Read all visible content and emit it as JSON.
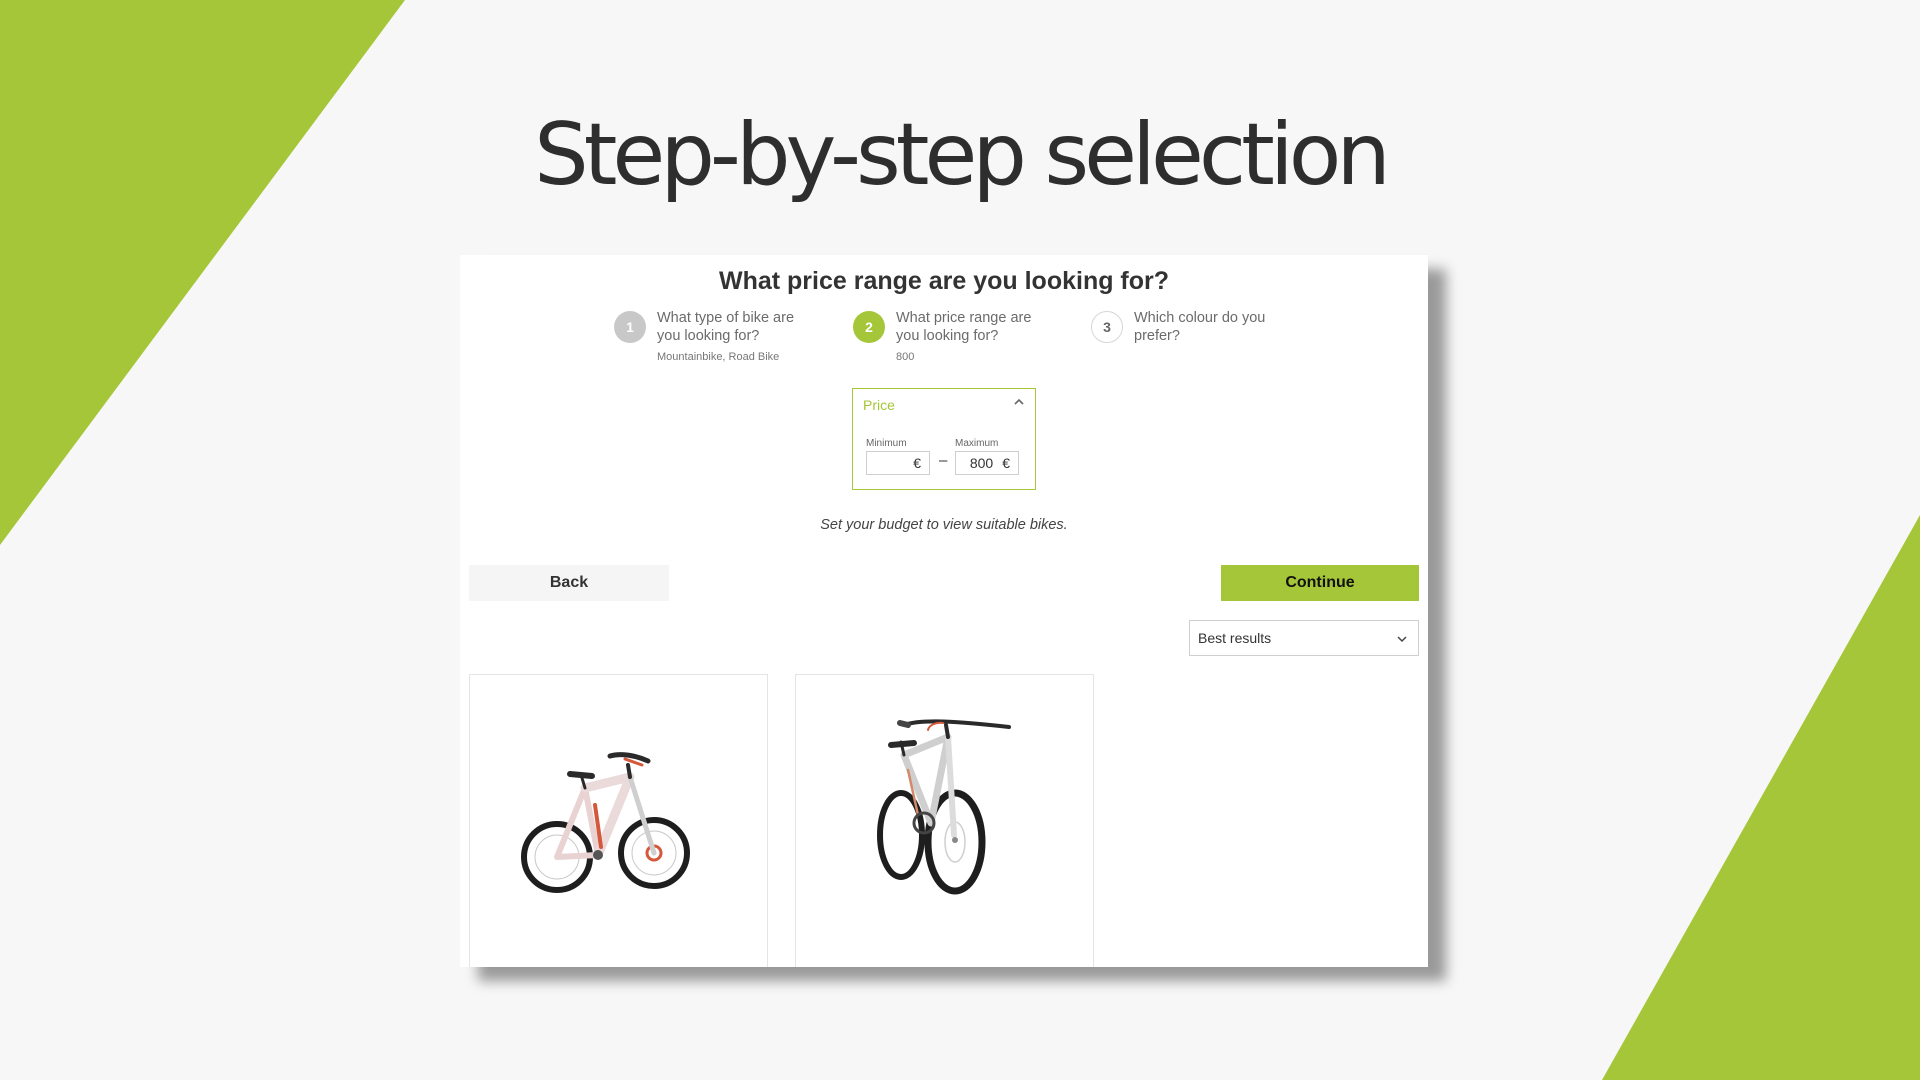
{
  "slide": {
    "title": "Step-by-step selection",
    "accent_color": "#a5c638"
  },
  "finder": {
    "question": "What price range are you looking for?",
    "steps": [
      {
        "number": "1",
        "label": "What type of bike are you looking for?",
        "answer": "Mountainbike, Road Bike",
        "state": "completed"
      },
      {
        "number": "2",
        "label": "What price range are you looking for?",
        "answer": "800",
        "state": "active"
      },
      {
        "number": "3",
        "label": "Which colour do you prefer?",
        "answer": "",
        "state": "pending"
      }
    ],
    "price_filter": {
      "title": "Price",
      "min_label": "Minimum",
      "max_label": "Maximum",
      "min_value": "",
      "max_value": "800",
      "currency": "€",
      "separator": "–",
      "expanded": true
    },
    "hint": "Set your budget to view suitable bikes.",
    "back_label": "Back",
    "continue_label": "Continue",
    "sort": {
      "selected": "Best results"
    },
    "products": [
      {
        "image": "e-mountain-bike-photo"
      },
      {
        "image": "mountain-bike-photo"
      }
    ]
  }
}
